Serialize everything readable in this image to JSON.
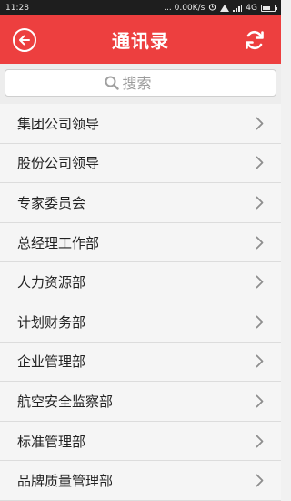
{
  "status_bar": {
    "time": "11:28",
    "network_speed": "... 0.00K/s",
    "network_type": "4G",
    "battery_level": 0.7
  },
  "app_bar": {
    "title": "通讯录",
    "back_icon": "back-circle-icon",
    "refresh_icon": "refresh-icon"
  },
  "search": {
    "placeholder": "搜索",
    "value": ""
  },
  "colors": {
    "accent": "#ed3f3f",
    "status_bar": "#1e1e1e",
    "background": "#f4f4f4"
  },
  "departments": [
    {
      "label": "集团公司领导"
    },
    {
      "label": "股份公司领导"
    },
    {
      "label": "专家委员会"
    },
    {
      "label": "总经理工作部"
    },
    {
      "label": "人力资源部"
    },
    {
      "label": "计划财务部"
    },
    {
      "label": "企业管理部"
    },
    {
      "label": "航空安全监察部"
    },
    {
      "label": "标准管理部"
    },
    {
      "label": "品牌质量管理部"
    }
  ]
}
